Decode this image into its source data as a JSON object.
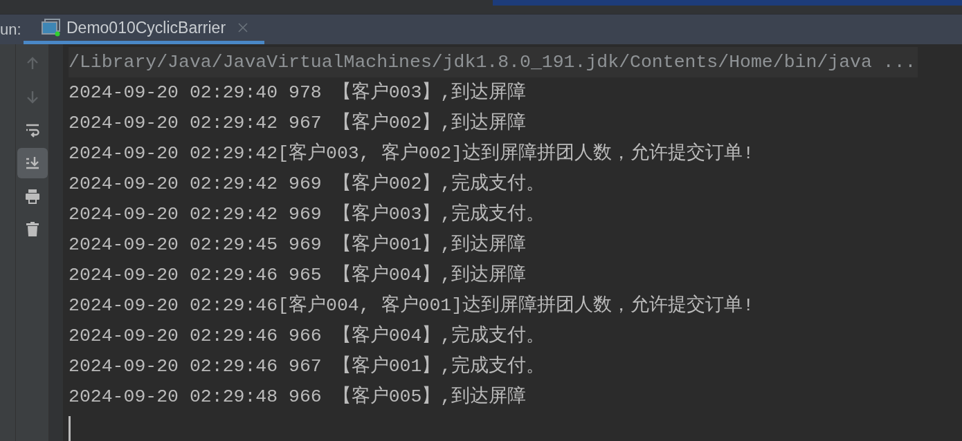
{
  "run_panel": {
    "label": "un:",
    "tabs": [
      {
        "label": "Demo010CyclicBarrier",
        "selected": true,
        "running": true
      }
    ]
  },
  "toolbar": [
    {
      "kind": "up",
      "disabled": true,
      "selected": false
    },
    {
      "kind": "down",
      "disabled": true,
      "selected": false
    },
    {
      "kind": "wrap",
      "disabled": false,
      "selected": false
    },
    {
      "kind": "scrollend",
      "disabled": false,
      "selected": true
    },
    {
      "kind": "print",
      "disabled": false,
      "selected": false
    },
    {
      "kind": "trash",
      "disabled": false,
      "selected": false
    }
  ],
  "console": {
    "lines": [
      {
        "kind": "command",
        "text": "/Library/Java/JavaVirtualMachines/jdk1.8.0_191.jdk/Contents/Home/bin/java ..."
      },
      {
        "kind": "output",
        "text": "2024-09-20 02:29:40 978 【客户003】,到达屏障"
      },
      {
        "kind": "output",
        "text": "2024-09-20 02:29:42 967 【客户002】,到达屏障"
      },
      {
        "kind": "output",
        "text": "2024-09-20 02:29:42[客户003, 客户002]达到屏障拼团人数，允许提交订单!"
      },
      {
        "kind": "output",
        "text": "2024-09-20 02:29:42 969 【客户002】,完成支付。"
      },
      {
        "kind": "output",
        "text": "2024-09-20 02:29:42 969 【客户003】,完成支付。"
      },
      {
        "kind": "output",
        "text": "2024-09-20 02:29:45 969 【客户001】,到达屏障"
      },
      {
        "kind": "output",
        "text": "2024-09-20 02:29:46 965 【客户004】,到达屏障"
      },
      {
        "kind": "output",
        "text": "2024-09-20 02:29:46[客户004, 客户001]达到屏障拼团人数，允许提交订单!"
      },
      {
        "kind": "output",
        "text": "2024-09-20 02:29:46 966 【客户004】,完成支付。"
      },
      {
        "kind": "output",
        "text": "2024-09-20 02:29:46 967 【客户001】,完成支付。"
      },
      {
        "kind": "output",
        "text": "2024-09-20 02:29:48 966 【客户005】,到达屏障"
      }
    ],
    "cursor": true
  }
}
